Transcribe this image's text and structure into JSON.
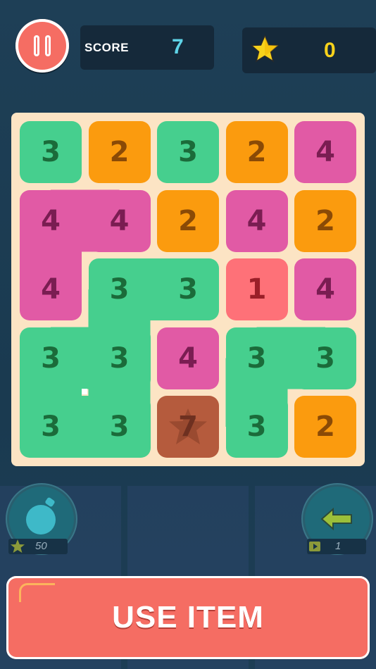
{
  "header": {
    "score_label": "SCORE",
    "score_value": "7",
    "stars_value": "0"
  },
  "colors": {
    "green": "#46cf8e",
    "orange": "#fb9b0e",
    "pink": "#e15aa5",
    "red": "#fe7178",
    "brown": "#b55b3d",
    "green_text": "#1b6b3a",
    "orange_text": "#8a4a06",
    "pink_text": "#7a1d52",
    "red_text": "#9a1f28",
    "brown_text": "#6e3020"
  },
  "board": {
    "rows": [
      [
        {
          "v": "3",
          "c": "green"
        },
        {
          "v": "2",
          "c": "orange"
        },
        {
          "v": "3",
          "c": "green"
        },
        {
          "v": "2",
          "c": "orange"
        },
        {
          "v": "4",
          "c": "pink"
        }
      ],
      [
        {
          "v": "4",
          "c": "pink"
        },
        {
          "v": "4",
          "c": "pink"
        },
        {
          "v": "2",
          "c": "orange"
        },
        {
          "v": "4",
          "c": "pink"
        },
        {
          "v": "2",
          "c": "orange"
        }
      ],
      [
        {
          "v": "4",
          "c": "pink"
        },
        {
          "v": "3",
          "c": "green"
        },
        {
          "v": "3",
          "c": "green"
        },
        {
          "v": "1",
          "c": "red"
        },
        {
          "v": "4",
          "c": "pink"
        }
      ],
      [
        {
          "v": "3",
          "c": "green"
        },
        {
          "v": "3",
          "c": "green"
        },
        {
          "v": "4",
          "c": "pink"
        },
        {
          "v": "3",
          "c": "green"
        },
        {
          "v": "3",
          "c": "green"
        }
      ],
      [
        {
          "v": "3",
          "c": "green"
        },
        {
          "v": "3",
          "c": "green"
        },
        {
          "v": "7",
          "c": "brown",
          "star": true
        },
        {
          "v": "3",
          "c": "green"
        },
        {
          "v": "2",
          "c": "orange"
        }
      ]
    ]
  },
  "items": {
    "bomb_cost": "50",
    "undo_count": "1"
  },
  "use_item_label": "USE ITEM"
}
